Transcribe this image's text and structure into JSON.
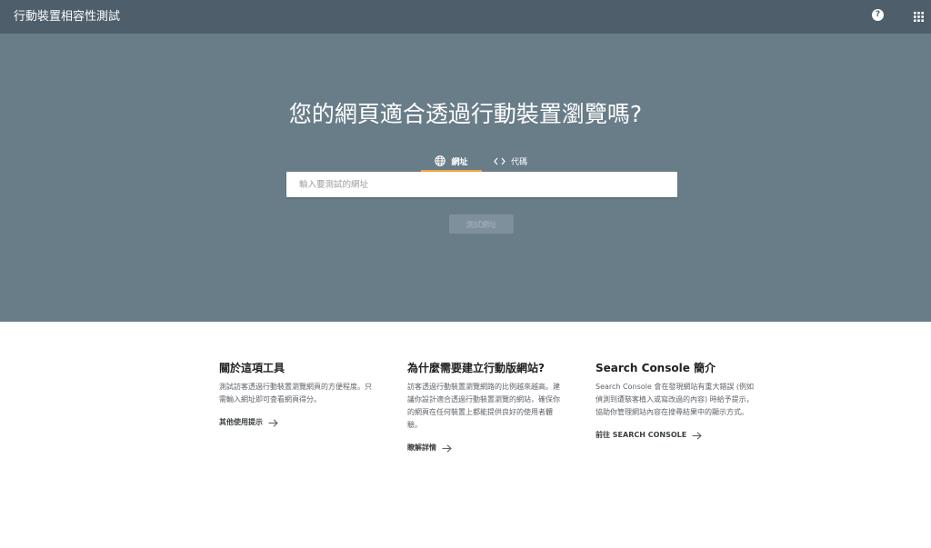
{
  "app_title": "行動裝置相容性測試",
  "topbar": {
    "help_icon": "help-circle-icon",
    "apps_icon": "apps-grid-icon",
    "help_glyph": "?"
  },
  "hero": {
    "title": "您的網頁適合透過行動裝置瀏覽嗎?",
    "tabs": [
      {
        "label": "網址",
        "icon": "globe-icon",
        "active": true
      },
      {
        "label": "代碼",
        "icon": "code-icon",
        "active": false
      }
    ],
    "url_input": {
      "value": "",
      "placeholder": "輸入要測試的網址"
    },
    "test_button_label": "測試網址"
  },
  "info": [
    {
      "heading": "關於這項工具",
      "body": "測試訪客透過行動裝置瀏覽網頁的方便程度。只需輸入網址即可查看網頁得分。",
      "link": "其他使用提示"
    },
    {
      "heading": "為什麼需要建立行動版網站?",
      "body": "訪客透過行動裝置瀏覽網路的比例越來越高。建議你設計適合透過行動裝置瀏覽的網站，確保你的網頁在任何裝置上都能提供良好的使用者體驗。",
      "link": "瞭解詳情"
    },
    {
      "heading": "Search Console 簡介",
      "body": "Search Console 會在發現網站有重大錯誤 (例如偵測到遭駭客植入或寫改過的內容) 時給予提示，協助你管理網站內容在搜尋結果中的顯示方式。",
      "link": "前往 SEARCH CONSOLE"
    }
  ],
  "colors": {
    "topbar": "#4e5f6b",
    "hero": "#697d89",
    "tab_accent": "#f3a43f",
    "button": "#7e909b"
  }
}
